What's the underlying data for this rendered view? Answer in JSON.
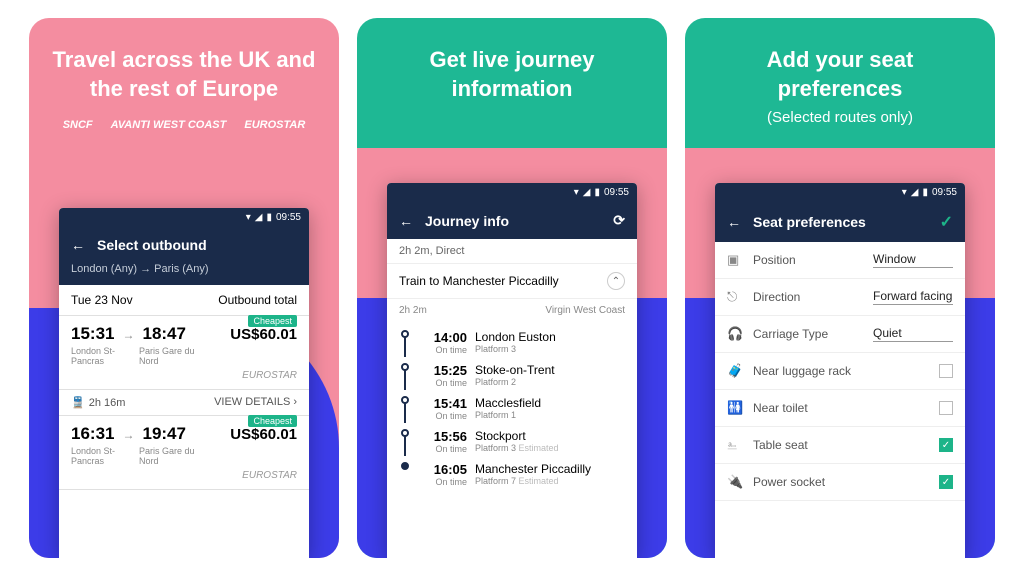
{
  "statusbar": {
    "time": "09:55"
  },
  "slide1": {
    "headline": "Travel across the UK and the rest of Europe",
    "logos": [
      "SNCF",
      "AVANTI WEST COAST",
      "EUROSTAR"
    ],
    "topbar_title": "Select outbound",
    "route": "London (Any) → Paris (Any)",
    "date": "Tue 23 Nov",
    "total_label": "Outbound total",
    "badge": "Cheapest",
    "results": [
      {
        "dep": "15:31",
        "arr": "18:47",
        "price": "US$60.01",
        "from": "London St-Pancras",
        "to": "Paris Gare du Nord",
        "operator": "EUROSTAR"
      },
      {
        "dep": "16:31",
        "arr": "19:47",
        "price": "US$60.01",
        "from": "London St-Pancras",
        "to": "Paris Gare du Nord",
        "operator": "EUROSTAR"
      }
    ],
    "duration": "2h 16m",
    "view_details": "VIEW DETAILS ›"
  },
  "slide2": {
    "headline": "Get live journey information",
    "topbar_title": "Journey info",
    "summary": "2h 2m, Direct",
    "segment_title": "Train to Manchester Piccadilly",
    "duration": "2h 2m",
    "operator": "Virgin West Coast",
    "stops": [
      {
        "time": "14:00",
        "status": "On time",
        "name": "London Euston",
        "platform": "Platform 3",
        "est": ""
      },
      {
        "time": "15:25",
        "status": "On time",
        "name": "Stoke-on-Trent",
        "platform": "Platform 2",
        "est": ""
      },
      {
        "time": "15:41",
        "status": "On time",
        "name": "Macclesfield",
        "platform": "Platform 1",
        "est": ""
      },
      {
        "time": "15:56",
        "status": "On time",
        "name": "Stockport",
        "platform": "Platform 3",
        "est": "Estimated"
      },
      {
        "time": "16:05",
        "status": "On time",
        "name": "Manchester Piccadilly",
        "platform": "Platform 7",
        "est": "Estimated"
      }
    ]
  },
  "slide3": {
    "headline": "Add your seat preferences",
    "subhead": "(Selected routes only)",
    "topbar_title": "Seat preferences",
    "selects": [
      {
        "label": "Position",
        "value": "Window"
      },
      {
        "label": "Direction",
        "value": "Forward facing"
      },
      {
        "label": "Carriage Type",
        "value": "Quiet"
      }
    ],
    "checks": [
      {
        "label": "Near luggage rack",
        "checked": false
      },
      {
        "label": "Near toilet",
        "checked": false
      },
      {
        "label": "Table seat",
        "checked": true
      },
      {
        "label": "Power socket",
        "checked": true
      }
    ]
  }
}
